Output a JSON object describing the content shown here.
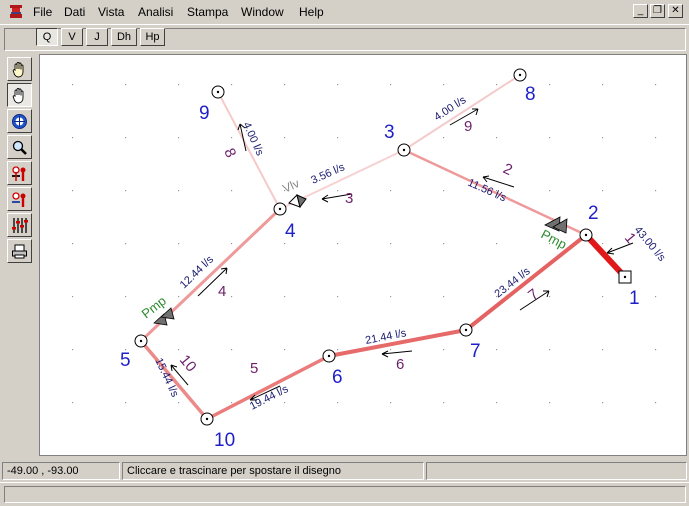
{
  "menu": [
    "File",
    "Dati",
    "Vista",
    "Analisi",
    "Stampa",
    "Window",
    "Help"
  ],
  "window_controls": {
    "minimize": "_",
    "restore": "❐",
    "close": "✕"
  },
  "variable_buttons": [
    "Q",
    "V",
    "J",
    "Dh",
    "Hp"
  ],
  "active_variable": "Q",
  "tools": [
    "pan-hand-icon",
    "grab-hand-icon",
    "target-icon",
    "zoom-icon",
    "add-node-icon",
    "remove-node-icon",
    "equalizer-icon",
    "print-icon"
  ],
  "status": {
    "coords": "-49.00 , -93.00",
    "message": "Cliccare e trascinare per spostare il disegno",
    "extra": ""
  },
  "network": {
    "nodes": [
      {
        "id": "1",
        "label": "1",
        "type": "reservoir"
      },
      {
        "id": "2",
        "label": "2"
      },
      {
        "id": "3",
        "label": "3"
      },
      {
        "id": "4",
        "label": "4"
      },
      {
        "id": "5",
        "label": "5"
      },
      {
        "id": "6",
        "label": "6"
      },
      {
        "id": "7",
        "label": "7"
      },
      {
        "id": "8",
        "label": "8"
      },
      {
        "id": "9",
        "label": "9"
      },
      {
        "id": "10",
        "label": "10"
      }
    ],
    "pipes": [
      {
        "id": "1",
        "label": "1",
        "from": "1",
        "to": "2",
        "flow": "43.00 l/s",
        "color": "#e01818"
      },
      {
        "id": "2",
        "label": "2",
        "from": "2",
        "to": "3",
        "flow": "11.56 l/s",
        "color": "#ef9a9a"
      },
      {
        "id": "3",
        "label": "3",
        "from": "3",
        "to": "4",
        "flow": "3.56 l/s",
        "color": "#f7d2d2"
      },
      {
        "id": "4",
        "label": "4",
        "from": "4",
        "to": "5",
        "flow": "12.44 l/s",
        "color": "#ef9a9a"
      },
      {
        "id": "5",
        "label": "5",
        "from": "6",
        "to": "10",
        "flow": "19.44 l/s",
        "color": "#ea7c7c"
      },
      {
        "id": "6",
        "label": "6",
        "from": "7",
        "to": "6",
        "flow": "21.44 l/s",
        "color": "#e66a6a"
      },
      {
        "id": "7",
        "label": "7",
        "from": "2",
        "to": "7",
        "flow": "23.44 l/s",
        "color": "#e46262"
      },
      {
        "id": "8",
        "label": "8",
        "from": "4",
        "to": "9",
        "flow": "4.00 l/s",
        "color": "#f5caca"
      },
      {
        "id": "9",
        "label": "9",
        "from": "3",
        "to": "8",
        "flow": "4.00 l/s",
        "color": "#f5caca"
      },
      {
        "id": "10",
        "label": "10",
        "from": "5",
        "to": "10",
        "flow": "15.44 l/s",
        "color": "#ec8a8a"
      }
    ],
    "devices": [
      {
        "type": "pump",
        "label": "Pmp",
        "pipe": "2",
        "color": "#2e8b2e"
      },
      {
        "type": "pump",
        "label": "Pmp",
        "pipe": "4",
        "color": "#2e8b2e"
      },
      {
        "type": "valve",
        "label": "Vlv",
        "pipe": "3",
        "color": "#8a8a8a"
      }
    ],
    "colors": {
      "node_label": "#1f1fc8",
      "pipe_label": "#6b1f6b",
      "flow_label": "#1a1a70"
    }
  }
}
